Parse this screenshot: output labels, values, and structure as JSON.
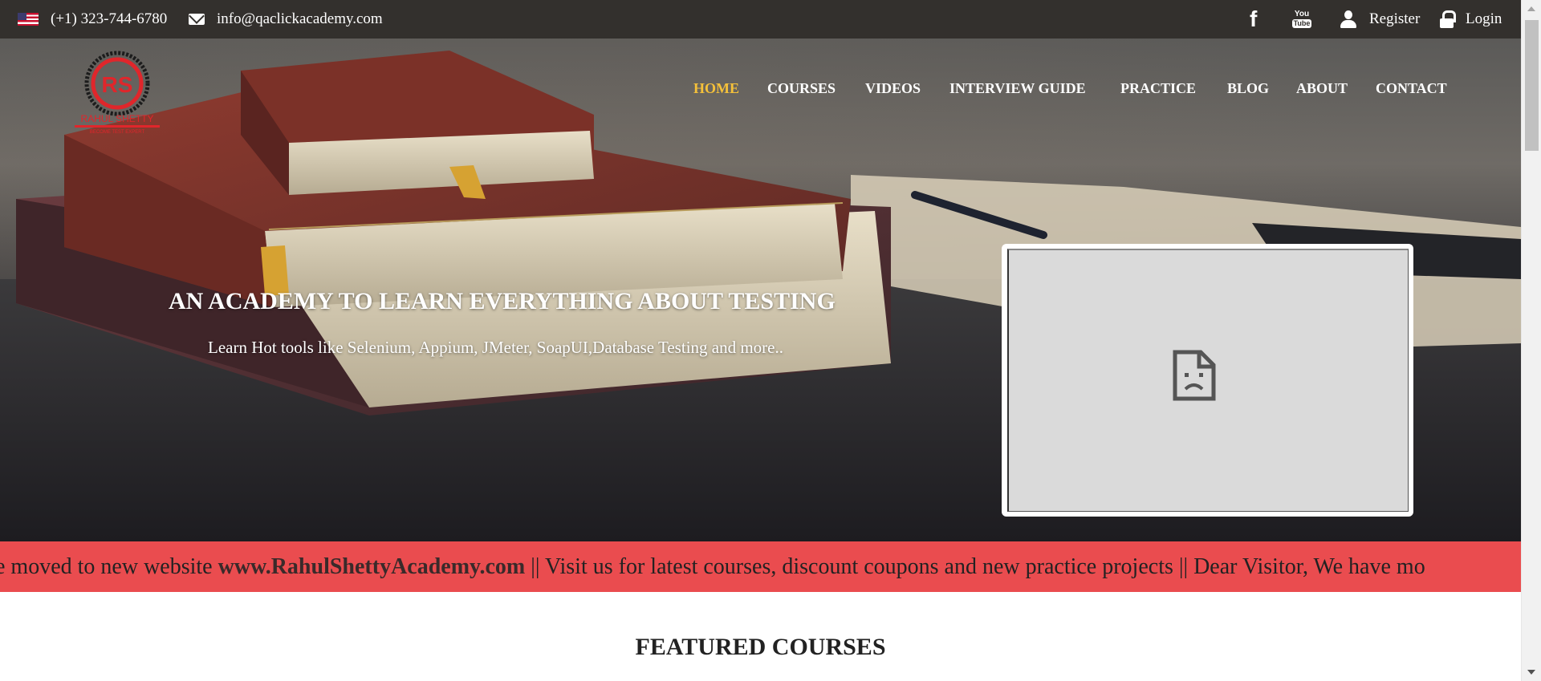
{
  "topbar": {
    "phone": "(+1) 323-744-6780",
    "email": "info@qaclickacademy.com",
    "register": "Register",
    "login": "Login",
    "facebook_glyph": "f",
    "youtube_line1": "You",
    "youtube_line2": "Tube"
  },
  "logo": {
    "monogram": "RS",
    "name": "RAHUL SHETTY",
    "tagline": "BECOME TEST EXPERT"
  },
  "nav": {
    "home": "HOME",
    "courses": "COURSES",
    "videos": "VIDEOS",
    "interview": "INTERVIEW GUIDE",
    "practice": "PRACTICE",
    "blog": "BLOG",
    "about": "ABOUT",
    "contact": "CONTACT"
  },
  "hero": {
    "title": "AN ACADEMY TO LEARN EVERYTHING ABOUT TESTING",
    "subtitle": "Learn Hot tools like Selenium, Appium, JMeter, SoapUI,Database Testing and more.."
  },
  "ticker": {
    "before": "e moved to new website ",
    "site": "www.RahulShettyAcademy.com",
    "after": " || Visit us for latest courses, discount coupons and new practice projects || Dear Visitor, We have mo"
  },
  "featured": {
    "heading": "FEATURED COURSES"
  },
  "colors": {
    "topbar_bg": "#33302d",
    "nav_active": "#f5c13a",
    "ticker_bg": "#ea4c4f"
  },
  "icons": [
    "us-flag-icon",
    "envelope-icon",
    "facebook-icon",
    "youtube-icon",
    "user-icon",
    "lock-icon",
    "sad-document-icon"
  ]
}
